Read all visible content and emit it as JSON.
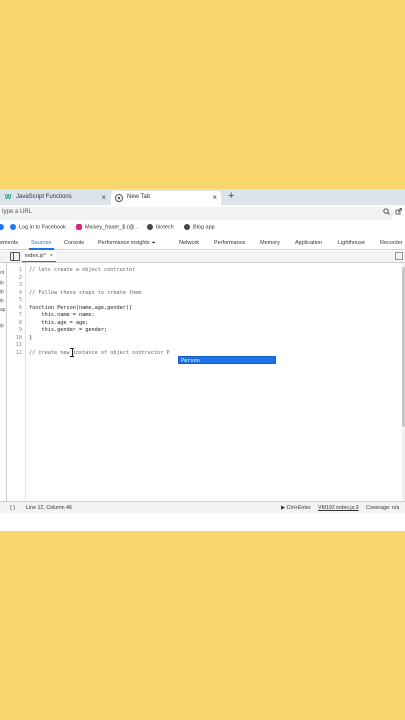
{
  "browser": {
    "tabs": [
      {
        "title": "JavaScript Functions",
        "icon": "w-logo-icon"
      },
      {
        "title": "New Tab",
        "icon": "chrome-icon"
      }
    ],
    "new_tab_symbol": "+",
    "close_symbol": "×",
    "address_placeholder": "type a URL",
    "bookmarks": [
      {
        "label": "Log in to Facebook",
        "icon": "facebook-icon",
        "color": "#1877f2"
      },
      {
        "label": "Mickey_fraser_$ (@...",
        "icon": "instagram-icon",
        "color": "#d62976"
      },
      {
        "label": "biotech",
        "icon": "globe-icon",
        "color": "#444444"
      },
      {
        "label": "Blog app",
        "icon": "globe-icon",
        "color": "#444444"
      }
    ]
  },
  "devtools": {
    "tabs": [
      "ements",
      "Sources",
      "Console",
      "Performance insights ⏶",
      "Network",
      "Performance",
      "Memory",
      "Application",
      "Lighthouse",
      "Recorder"
    ],
    "active_tab": "Sources",
    "file_tab": "index.js*",
    "file_tab_close": "×",
    "navigator_fragments": [
      "ot",
      "ip",
      "ip",
      "ip",
      "ap",
      "ip"
    ],
    "code_lines": [
      {
        "n": "1",
        "text": "// lets create a object contructor"
      },
      {
        "n": "2",
        "text": ""
      },
      {
        "n": "3",
        "text": ""
      },
      {
        "n": "4",
        "text": "// Follow these steps to create them"
      },
      {
        "n": "5",
        "text": ""
      },
      {
        "n": "6",
        "text": "function Person(name,age,gender){"
      },
      {
        "n": "7",
        "text": "    this.name = name;"
      },
      {
        "n": "8",
        "text": "    this.age = age;"
      },
      {
        "n": "9",
        "text": "    this.gender = gender;"
      },
      {
        "n": "10",
        "text": "}"
      },
      {
        "n": "11",
        "text": ""
      },
      {
        "n": "12",
        "text": "// create new instance of object contructor P"
      }
    ],
    "autocomplete": "Person",
    "status": {
      "braces": "{ }",
      "position": "Line 12, Column 46",
      "run_hint": "▶ Ctrl+Enter",
      "source_link": "VM192 index.js:3",
      "coverage": "Coverage: n/a"
    }
  },
  "colors": {
    "background": "#f9d66b",
    "accent": "#1a73e8"
  }
}
